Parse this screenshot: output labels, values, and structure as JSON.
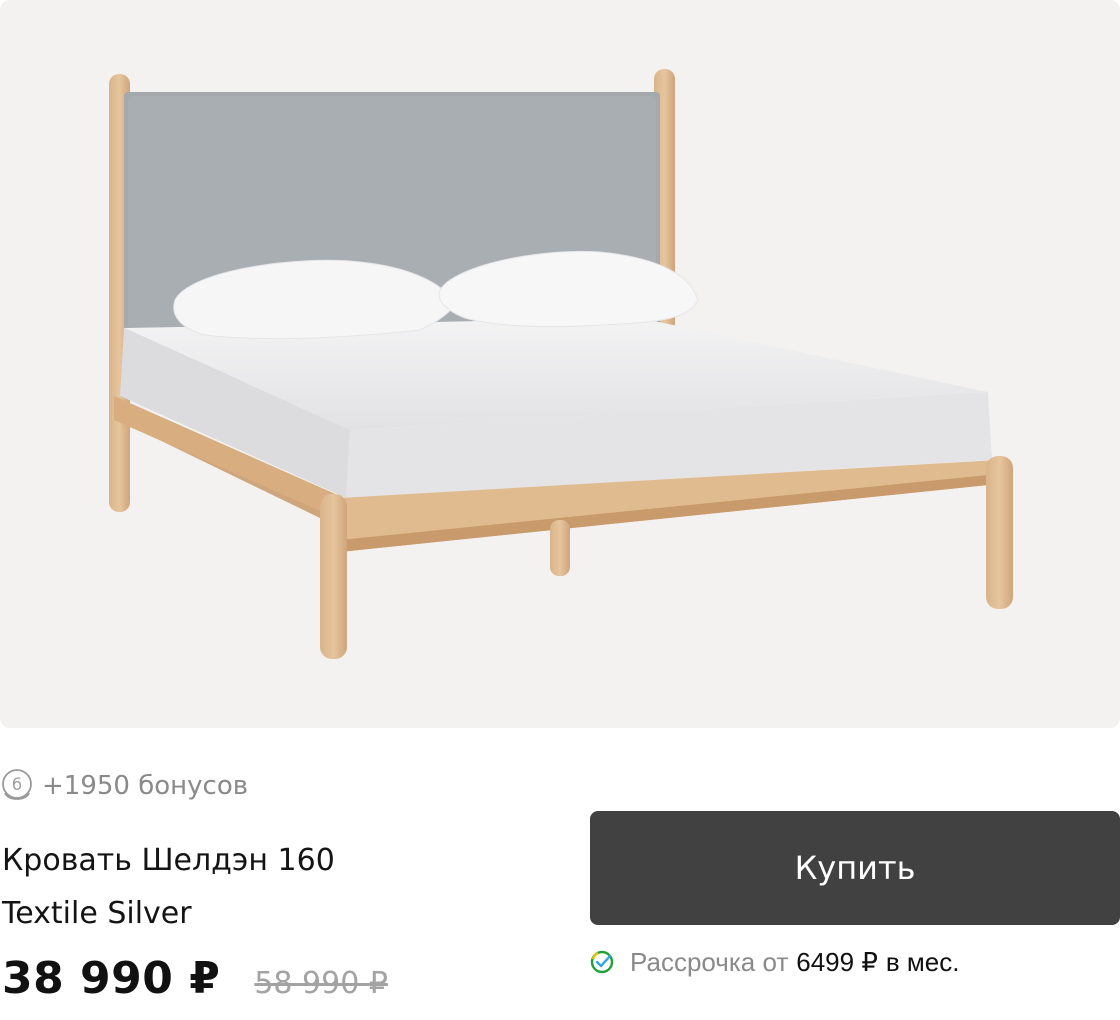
{
  "product": {
    "image_alt": "Кровать Шелдэн 160 Textile Silver",
    "bonus_text": "+1950 бонусов",
    "bonus_icon": "bonus-coin-icon",
    "title_line1": "Кровать Шелдэн 160",
    "title_line2": "Textile Silver",
    "price": "38 990 ₽",
    "old_price": "58 990 ₽"
  },
  "actions": {
    "buy_label": "Купить"
  },
  "installment": {
    "icon": "sber-check-icon",
    "prefix": "Рассрочка от",
    "amount": "6499 ₽",
    "suffix": "в мес."
  },
  "colors": {
    "button_bg": "#414141",
    "photo_bg": "#f4f2f1",
    "muted_text": "#8a8a8a",
    "old_price": "#a3a3a3"
  }
}
